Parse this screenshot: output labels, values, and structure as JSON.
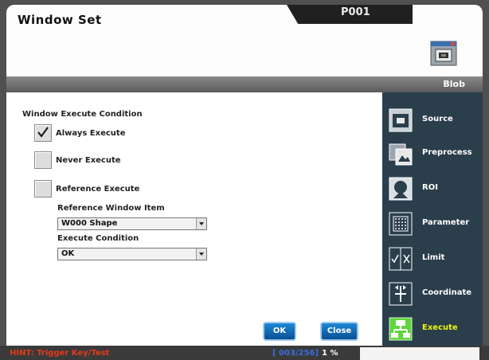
{
  "header": {
    "title": "Window Set",
    "page_id": "P001"
  },
  "section": {
    "label": "Blob"
  },
  "condition": {
    "title": "Window Execute Condition",
    "options": [
      {
        "label": "Always Execute",
        "checked": true
      },
      {
        "label": "Never Execute",
        "checked": false
      },
      {
        "label": "Reference Execute",
        "checked": false
      }
    ],
    "reference_item_label": "Reference Window Item",
    "reference_item_value": "W000 Shape",
    "execute_condition_label": "Execute Condition",
    "execute_condition_value": "OK"
  },
  "buttons": {
    "ok": "OK",
    "close": "Close"
  },
  "sidebar": {
    "items": [
      {
        "label": "Source",
        "icon": "source-icon"
      },
      {
        "label": "Preprocess",
        "icon": "preprocess-icon"
      },
      {
        "label": "ROI",
        "icon": "roi-icon"
      },
      {
        "label": "Parameter",
        "icon": "parameter-icon"
      },
      {
        "label": "Limit",
        "icon": "limit-icon"
      },
      {
        "label": "Coordinate",
        "icon": "coordinate-icon"
      },
      {
        "label": "Execute",
        "icon": "execute-icon",
        "active": true
      }
    ]
  },
  "status": {
    "hint": "HINT: Trigger Key/Test",
    "counter": "[ 003/256]",
    "percent": "1 %"
  },
  "colors": {
    "sidebar_bg": "#2b3e4c",
    "active_label": "#e9f60a",
    "hint": "#e23a1a",
    "counter": "#3a6ee0",
    "button": "#0a66b8"
  }
}
